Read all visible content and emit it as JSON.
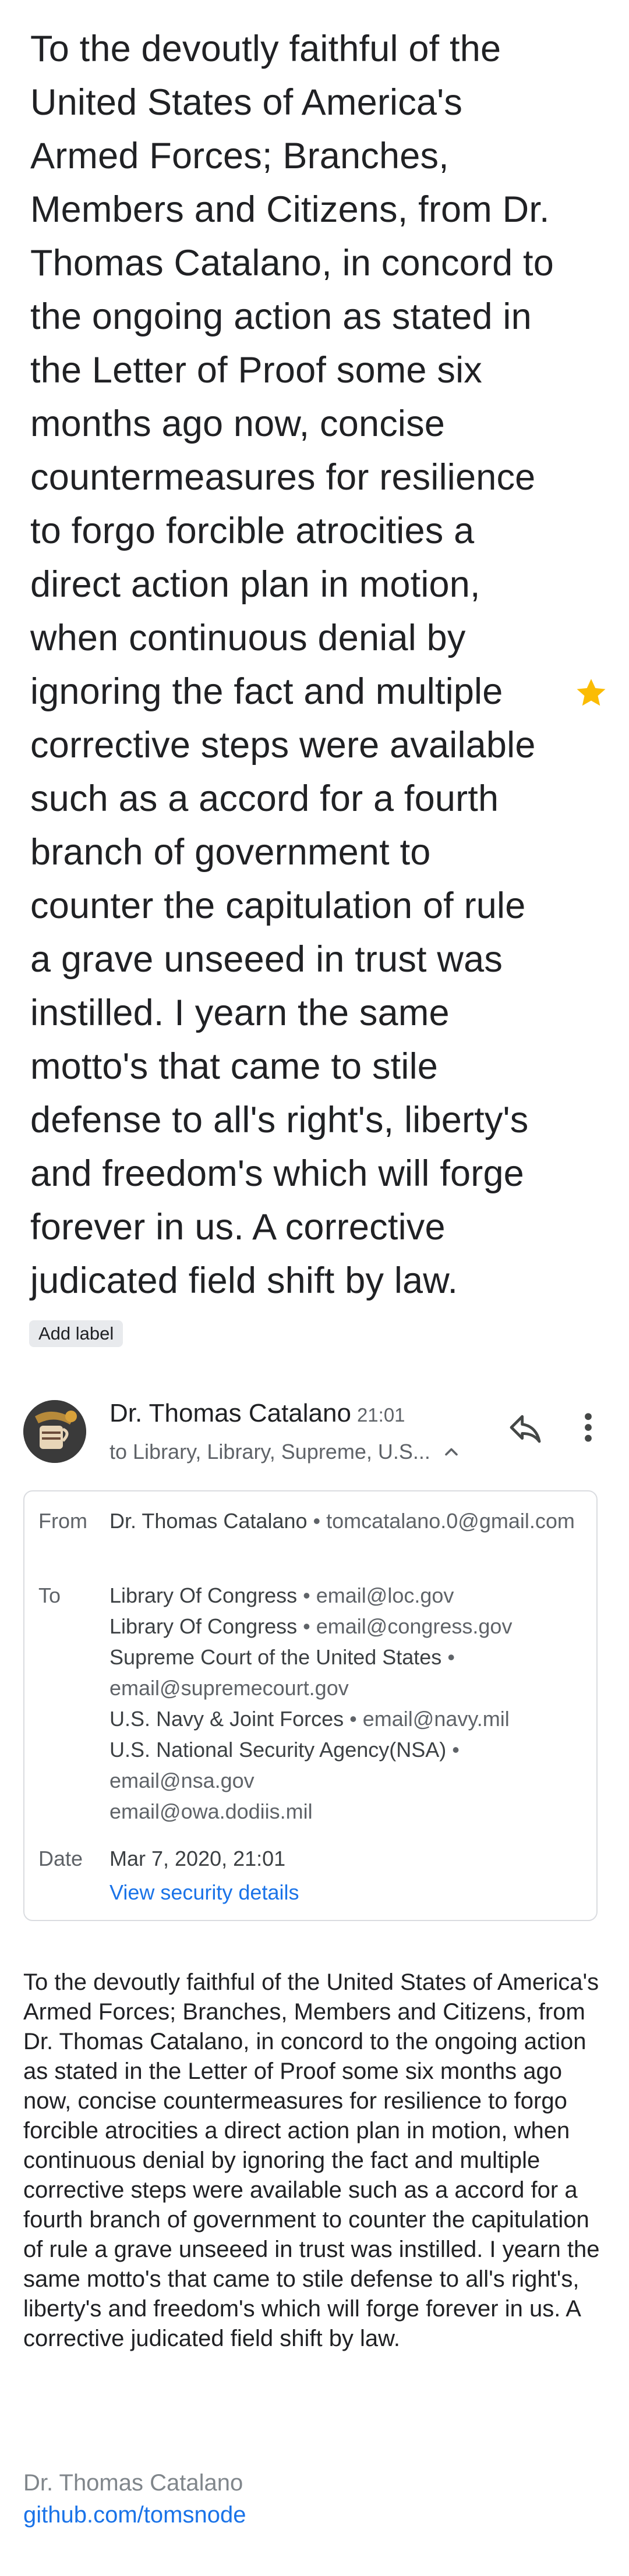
{
  "subject": "To the devoutly faithful of the United States of America's Armed Forces; Branches, Members and Citizens, from Dr. Thomas Catalano, in concord to the ongoing action as stated in the Letter of Proof some six months ago now, concise countermeasures for resilience to forgo forcible atrocities a direct action plan in motion, when continuous denial by ignoring the fact and multiple corrective steps were available such as a accord for a fourth branch of government to counter the capitulation of rule a grave unseeed in trust was instilled. I yearn the same motto's that came to stile defense to all's right's, liberty's and freedom's which will forge forever in us. A corrective judicated field shift by law.",
  "add_label": "Add label",
  "sender": {
    "name": "Dr. Thomas Catalano",
    "time": "21:01",
    "recipients_summary": "to Library, Library, Supreme, U.S..."
  },
  "details": {
    "from_label": "From",
    "from_name": "Dr. Thomas Catalano",
    "from_email": "tomcatalano.0@gmail.com",
    "to_label": "To",
    "to_lines": [
      {
        "name": "Library Of Congress",
        "email": "email@loc.gov"
      },
      {
        "name": "Library Of Congress",
        "email": "email@congress.gov"
      },
      {
        "name": "Supreme Court of the United States",
        "email": "email@supremecourt.gov"
      },
      {
        "name": "U.S. Navy & Joint Forces",
        "email": "email@navy.mil"
      },
      {
        "name": "U.S. National Security Agency(NSA)",
        "email": "email@nsa.gov"
      },
      {
        "name": "",
        "email": "email@owa.dodiis.mil"
      }
    ],
    "date_label": "Date",
    "date_value": "Mar 7, 2020, 21:01",
    "security_link": "View security details"
  },
  "body": "To the devoutly faithful of the United States of America's Armed Forces; Branches, Members and Citizens, from Dr. Thomas Catalano, in concord to the ongoing action as stated in the Letter of Proof some six months ago now, concise countermeasures for resilience to forgo forcible atrocities a direct action plan in motion, when continuous denial by ignoring the fact and multiple corrective steps were available such as a accord for a fourth branch of government to counter the capitulation of rule a grave unseeed in trust was instilled. I yearn the same motto's that came to stile defense to all's right's, liberty's and freedom's which will forge forever in us. A corrective judicated field shift by law.",
  "signature": {
    "name": "Dr. Thomas Catalano",
    "link": "github.com/tomsnode"
  },
  "colors": {
    "star": "#fbbc04",
    "link": "#1a73e8",
    "secondary_text": "#5f6368"
  },
  "icons": [
    "star-icon",
    "reply-icon",
    "more-vert-icon",
    "chevron-up-icon",
    "avatar"
  ]
}
